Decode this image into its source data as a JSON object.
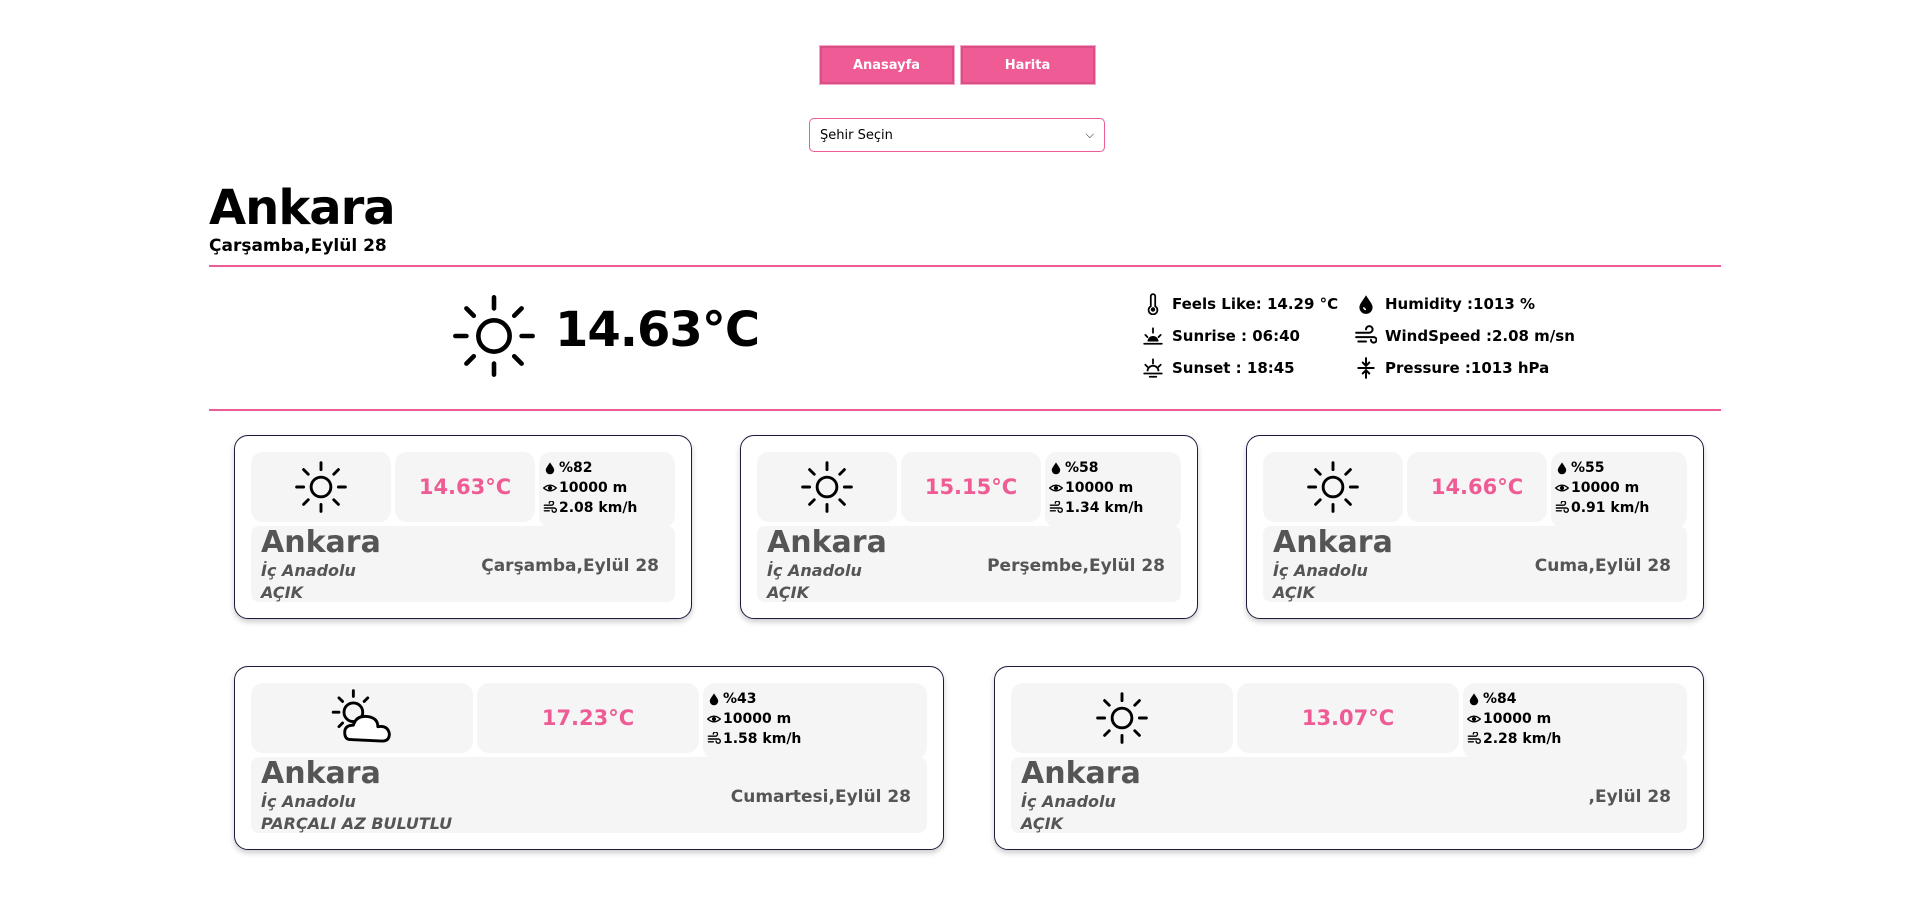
{
  "nav": {
    "home_label": "Anasayfa",
    "map_label": "Harita"
  },
  "city_select": {
    "selected": "Şehir Seçin"
  },
  "current": {
    "city": "Ankara",
    "date": "Çarşamba,Eylül 28",
    "temp": "14.63°C",
    "icon": "sun-icon",
    "feels_like": "Feels Like: 14.29 °C",
    "sunrise": "Sunrise : 06:40",
    "sunset": "Sunset : 18:45",
    "humidity": "Humidity :1013 %",
    "wind": "WindSpeed :2.08 m/sn",
    "pressure": "Pressure :1013 hPa"
  },
  "forecast": [
    {
      "temp": "14.63°C",
      "humidity": "%82",
      "visibility": "10000 m",
      "wind": "2.08 km/h",
      "city": "Ankara",
      "region": "İç Anadolu",
      "condition": "AÇIK",
      "date": "Çarşamba,Eylül 28",
      "icon": "sun-icon"
    },
    {
      "temp": "15.15°C",
      "humidity": "%58",
      "visibility": "10000 m",
      "wind": "1.34 km/h",
      "city": "Ankara",
      "region": "İç Anadolu",
      "condition": "AÇIK",
      "date": "Perşembe,Eylül 28",
      "icon": "sun-icon"
    },
    {
      "temp": "14.66°C",
      "humidity": "%55",
      "visibility": "10000 m",
      "wind": "0.91 km/h",
      "city": "Ankara",
      "region": "İç Anadolu",
      "condition": "AÇIK",
      "date": "Cuma,Eylül 28",
      "icon": "sun-icon"
    },
    {
      "temp": "17.23°C",
      "humidity": "%43",
      "visibility": "10000 m",
      "wind": "1.58 km/h",
      "city": "Ankara",
      "region": "İç Anadolu",
      "condition": "PARÇALI AZ BULUTLU",
      "date": "Cumartesi,Eylül 28",
      "icon": "partly-cloudy-icon"
    },
    {
      "temp": "13.07°C",
      "humidity": "%84",
      "visibility": "10000 m",
      "wind": "2.28 km/h",
      "city": "Ankara",
      "region": "İç Anadolu",
      "condition": "AÇIK",
      "date": ",Eylül 28",
      "icon": "sun-icon"
    }
  ],
  "colors": {
    "accent": "#ef5b95",
    "card_border": "#1f1a3d",
    "tile_bg": "#f5f5f5"
  }
}
